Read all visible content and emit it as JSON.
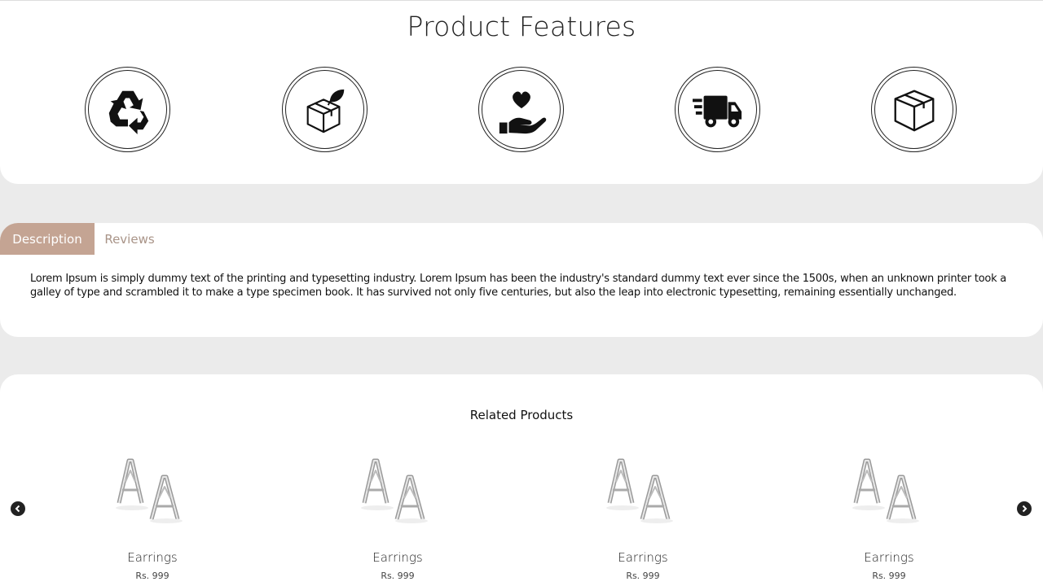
{
  "features": {
    "title": "Product Features",
    "icons": [
      "recycle-icon",
      "eco-box-icon",
      "heart-hand-icon",
      "fast-delivery-truck-icon",
      "package-box-icon"
    ]
  },
  "tabs": {
    "description_label": "Description",
    "reviews_label": "Reviews",
    "active": "Description",
    "active_color": "#c4a493",
    "description_text": "Lorem Ipsum is simply dummy text of the printing and typesetting industry. Lorem Ipsum has been the industry's standard dummy text ever since the 1500s, when an unknown printer took a galley of type and scrambled it to make a type specimen book. It has survived not only five centuries, but also the leap into electronic typesetting, remaining essentially unchanged."
  },
  "related": {
    "title": "Related Products",
    "products": [
      {
        "name": "Earrings",
        "price": "Rs. 999"
      },
      {
        "name": "Earrings",
        "price": "Rs. 999"
      },
      {
        "name": "Earrings",
        "price": "Rs. 999"
      },
      {
        "name": "Earrings",
        "price": "Rs. 999"
      }
    ],
    "prev_icon": "chevron-left-icon",
    "next_icon": "chevron-right-icon"
  }
}
